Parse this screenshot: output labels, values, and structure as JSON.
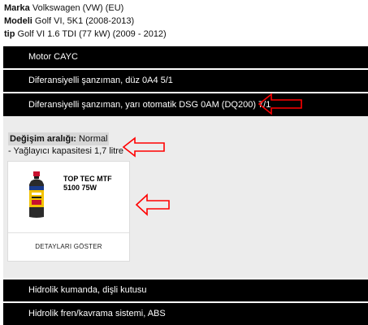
{
  "vehicle": {
    "brand_label": "Marka",
    "brand_value": " Volkswagen (VW) (EU)",
    "model_label": "Modeli",
    "model_value": " Golf VI, 5K1 (2008-2013)",
    "type_label": "tip",
    "type_value": " Golf VI 1.6 TDI (77 kW) (2009 - 2012)"
  },
  "bars": {
    "motor": "Motor CAYC",
    "manual": "Diferansiyelli şanzıman, düz 0A4 5/1",
    "dsg": "Diferansiyelli şanzıman, yarı otomatik DSG 0AM (DQ200) 7/1",
    "hydraulic": "Hidrolik kumanda, dişli kutusu",
    "brake": "Hidrolik fren/kavrama sistemi, ABS"
  },
  "details": {
    "interval_label": "Değişim aralığı:",
    "interval_value": " Normal",
    "capacity": "- Yağlayıcı kapasitesi 1,7 litre"
  },
  "product": {
    "name": "TOP TEC MTF 5100 75W",
    "details_button": "DETAYLARI GÖSTER"
  },
  "colors": {
    "bar_bg": "#000000",
    "panel_bg": "#ececec",
    "annotation_arrow": "#ff0000"
  }
}
